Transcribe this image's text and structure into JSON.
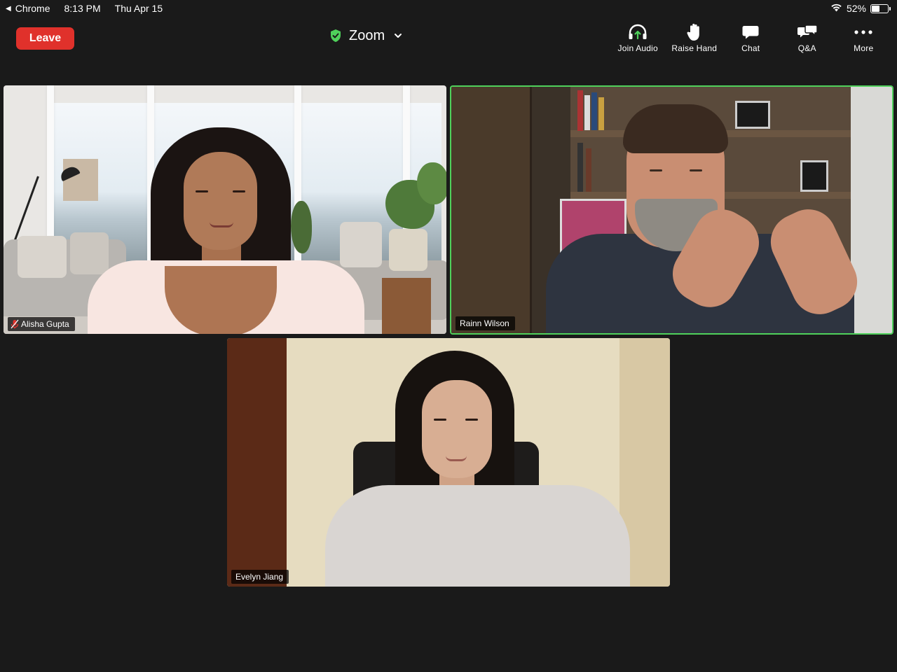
{
  "status_bar": {
    "back_app": "Chrome",
    "time": "8:13 PM",
    "date": "Thu Apr 15",
    "battery_percent": "52%",
    "battery_level": 0.52
  },
  "header": {
    "leave_label": "Leave",
    "meeting_title": "Zoom",
    "toolbar": [
      {
        "label": "Join Audio",
        "icon": "headphones-arrow-icon"
      },
      {
        "label": "Raise Hand",
        "icon": "hand-icon"
      },
      {
        "label": "Chat",
        "icon": "chat-bubble-icon"
      },
      {
        "label": "Q&A",
        "icon": "qa-bubbles-icon"
      },
      {
        "label": "More",
        "icon": "more-dots-icon"
      }
    ]
  },
  "participants": [
    {
      "name": "Alisha Gupta",
      "muted": true,
      "active_speaker": false
    },
    {
      "name": "Rainn Wilson",
      "muted": false,
      "active_speaker": true
    },
    {
      "name": "Evelyn Jiang",
      "muted": false,
      "active_speaker": false
    }
  ],
  "colors": {
    "background": "#1a1a1a",
    "leave_button": "#e0312b",
    "active_speaker_border": "#4fd15b",
    "shield_green": "#4fd15b",
    "mute_red": "#e0312b",
    "join_audio_arrow": "#4fd15b"
  }
}
